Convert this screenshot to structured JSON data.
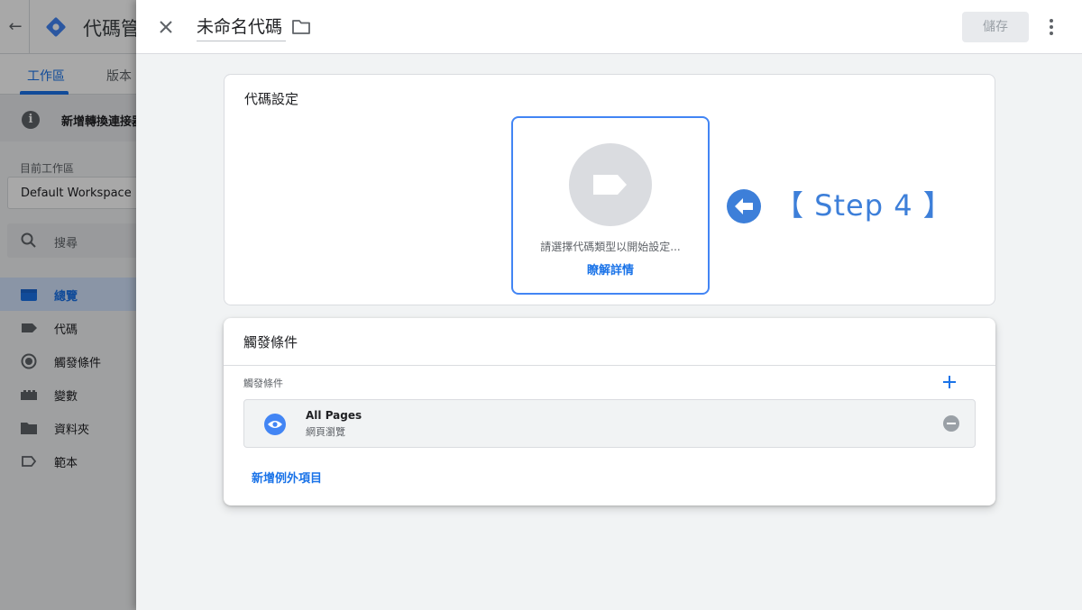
{
  "background": {
    "app_title": "代碼管",
    "tabs": [
      {
        "label": "工作區",
        "active": true
      },
      {
        "label": "版本",
        "active": false
      }
    ],
    "notice": "新增轉換連接器",
    "workspace_label": "目前工作區",
    "workspace_name": "Default Workspace",
    "search_placeholder": "搜尋",
    "nav": [
      {
        "label": "總覽",
        "icon": "overview-icon",
        "active": true
      },
      {
        "label": "代碼",
        "icon": "tag-icon",
        "active": false
      },
      {
        "label": "觸發條件",
        "icon": "trigger-icon",
        "active": false
      },
      {
        "label": "變數",
        "icon": "variable-icon",
        "active": false
      },
      {
        "label": "資料夾",
        "icon": "folder-icon",
        "active": false
      },
      {
        "label": "範本",
        "icon": "template-icon",
        "active": false
      }
    ]
  },
  "panel": {
    "tag_name": "未命名代碼",
    "save_label": "儲存"
  },
  "tag_config": {
    "title": "代碼設定",
    "prompt": "請選擇代碼類型以開始設定...",
    "learn_more": "瞭解詳情",
    "step_label": "【 Step 4 】"
  },
  "triggering": {
    "title": "觸發條件",
    "subtitle": "觸發條件",
    "trigger": {
      "name": "All Pages",
      "type": "網頁瀏覽"
    },
    "add_exception": "新增例外項目"
  },
  "colors": {
    "accent": "#1a73e8",
    "step": "#3d7fd9"
  }
}
